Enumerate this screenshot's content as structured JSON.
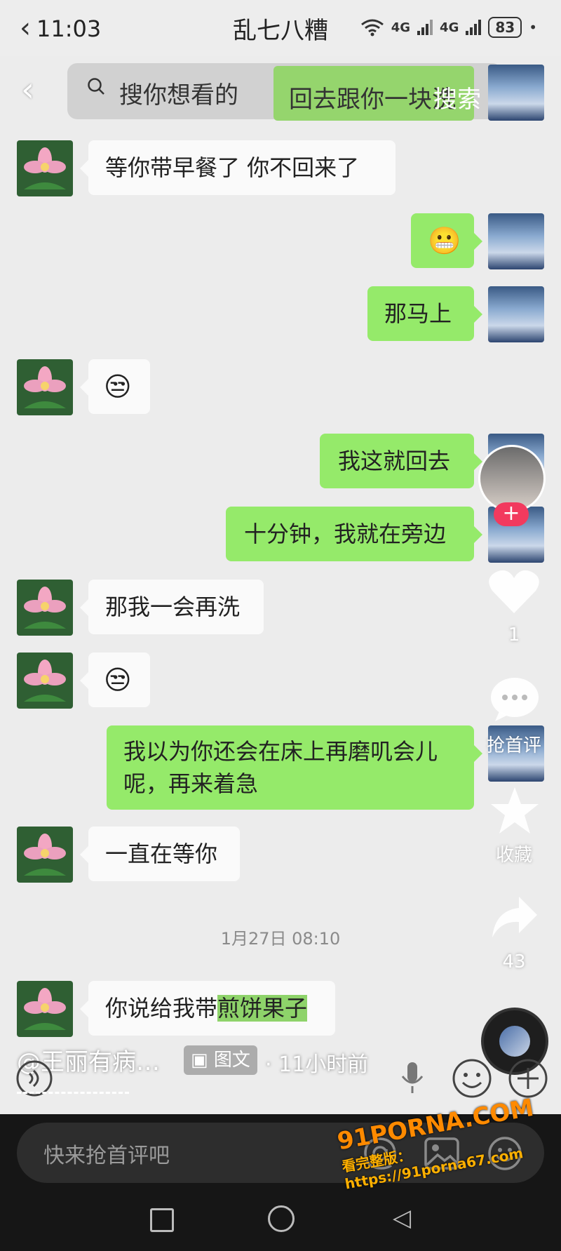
{
  "status_bar": {
    "time": "11:03",
    "chat_title": "乱七八糟",
    "network_1": "4G",
    "network_2": "4G",
    "battery": "83"
  },
  "search": {
    "placeholder": "搜你想看的",
    "suggestion": "回去跟你一块洗",
    "button": "搜索"
  },
  "messages": [
    {
      "side": "left",
      "text": "等你带早餐了  你不回来了"
    },
    {
      "side": "right",
      "text": "😬"
    },
    {
      "side": "right",
      "text": "那马上"
    },
    {
      "side": "left",
      "text": "😒"
    },
    {
      "side": "right",
      "text": "我这就回去"
    },
    {
      "side": "right",
      "text": "十分钟，我就在旁边"
    },
    {
      "side": "left",
      "text": "那我一会再洗"
    },
    {
      "side": "left",
      "text": "😒"
    },
    {
      "side": "right",
      "text_line1": "我以为你还会在床上再磨叽会儿",
      "text_line2": "呢，再来着急"
    },
    {
      "side": "left",
      "text": "一直在等你"
    },
    {
      "side": "left",
      "text_plain": "你说给我带",
      "text_highlight": "煎饼果子"
    }
  ],
  "timestamp": "1月27日 08:10",
  "rail": {
    "like_count": "1",
    "comment_label": "抢首评",
    "favorite_label": "收藏",
    "share_count": "43"
  },
  "post": {
    "author": "@王丽有病…",
    "tag": "图文",
    "time_ago": "· 11小时前"
  },
  "comment": {
    "placeholder": "快来抢首评吧"
  },
  "watermark": {
    "logo": "91PORNA.COM",
    "line": "看完整版：https://91porna67.com"
  }
}
